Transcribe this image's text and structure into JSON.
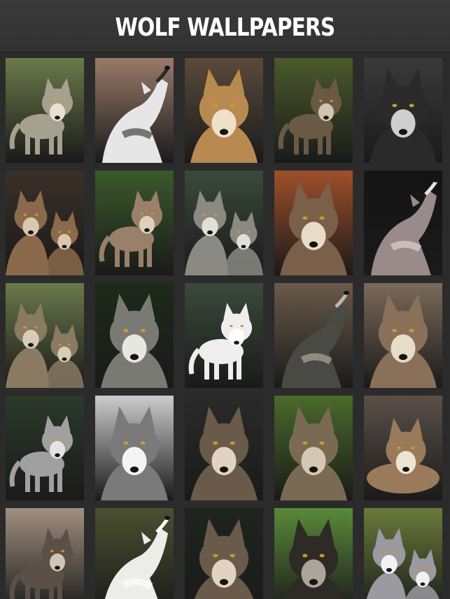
{
  "app": {
    "title": "WOLF WALLPAPERS"
  },
  "wallpapers": [
    {
      "name": "wolf-1",
      "bg": "#6a7a4a",
      "wolf": "#a6a08e",
      "accent": "#e8e2d4",
      "pose": "stand"
    },
    {
      "name": "wolf-2",
      "bg": "#9a7a6a",
      "wolf": "#e6e6e6",
      "accent": "#2a2a2a",
      "pose": "howl"
    },
    {
      "name": "wolf-3",
      "bg": "#5a4a3a",
      "wolf": "#b88a50",
      "accent": "#f0e0c8",
      "pose": "face"
    },
    {
      "name": "wolf-4",
      "bg": "#4a5a2a",
      "wolf": "#6a5a44",
      "accent": "#cfc4b0",
      "pose": "stand"
    },
    {
      "name": "wolf-5",
      "bg": "#3a3a3a",
      "wolf": "#2a2a2a",
      "accent": "#cfcfcf",
      "pose": "face"
    },
    {
      "name": "wolf-6",
      "bg": "#3a3028",
      "wolf": "#8a6a4a",
      "accent": "#d8c8b0",
      "pose": "pair"
    },
    {
      "name": "wolf-7",
      "bg": "#3a5a2a",
      "wolf": "#9a8068",
      "accent": "#ddd0bc",
      "pose": "stand"
    },
    {
      "name": "wolf-8",
      "bg": "#3a4a3a",
      "wolf": "#8a8a82",
      "accent": "#e0e0d8",
      "pose": "pair"
    },
    {
      "name": "wolf-9",
      "bg": "#a0502a",
      "wolf": "#7a6048",
      "accent": "#e8dcc8",
      "pose": "face"
    },
    {
      "name": "wolf-10",
      "bg": "#141414",
      "wolf": "#9a8a8a",
      "accent": "#e8e0e0",
      "pose": "howl"
    },
    {
      "name": "wolf-11",
      "bg": "#6a7a4a",
      "wolf": "#8a7a62",
      "accent": "#d8ccb8",
      "pose": "pair"
    },
    {
      "name": "wolf-12",
      "bg": "#1e2a1a",
      "wolf": "#7a7a74",
      "accent": "#e8e6e0",
      "pose": "face"
    },
    {
      "name": "wolf-13",
      "bg": "#3a4a3a",
      "wolf": "#eeeeee",
      "accent": "#ffffff",
      "pose": "stand"
    },
    {
      "name": "wolf-14",
      "bg": "#6a5a4a",
      "wolf": "#4a4a44",
      "accent": "#bfb8a8",
      "pose": "howl"
    },
    {
      "name": "wolf-15",
      "bg": "#7a6a5a",
      "wolf": "#8a7058",
      "accent": "#e6dcc8",
      "pose": "face"
    },
    {
      "name": "wolf-16",
      "bg": "#2a3a2a",
      "wolf": "#a0a0a0",
      "accent": "#e4e4e4",
      "pose": "stand"
    },
    {
      "name": "wolf-17",
      "bg": "#cccccc",
      "wolf": "#7a7a7a",
      "accent": "#f4f4f4",
      "pose": "face"
    },
    {
      "name": "wolf-18",
      "bg": "#2a2a2a",
      "wolf": "#6a5a4a",
      "accent": "#e0d4c0",
      "pose": "face"
    },
    {
      "name": "wolf-19",
      "bg": "#4a6a2a",
      "wolf": "#7a6a54",
      "accent": "#d4c8b4",
      "pose": "face"
    },
    {
      "name": "wolf-20",
      "bg": "#5a5048",
      "wolf": "#9a7a5a",
      "accent": "#ece4d4",
      "pose": "lying"
    },
    {
      "name": "wolf-21",
      "bg": "#a09080",
      "wolf": "#5a5048",
      "accent": "#d0c4b4",
      "pose": "stand"
    },
    {
      "name": "wolf-22",
      "bg": "#4a5030",
      "wolf": "#ecece8",
      "accent": "#ffffff",
      "pose": "howl"
    },
    {
      "name": "wolf-23",
      "bg": "#1e241e",
      "wolf": "#6a5a4a",
      "accent": "#e0d4c0",
      "pose": "face"
    },
    {
      "name": "wolf-24",
      "bg": "#5a8a3a",
      "wolf": "#2e2a26",
      "accent": "#aaa49a",
      "pose": "face"
    },
    {
      "name": "wolf-25",
      "bg": "#6a7a3a",
      "wolf": "#9a9aa0",
      "accent": "#f2f2f2",
      "pose": "pair"
    }
  ]
}
